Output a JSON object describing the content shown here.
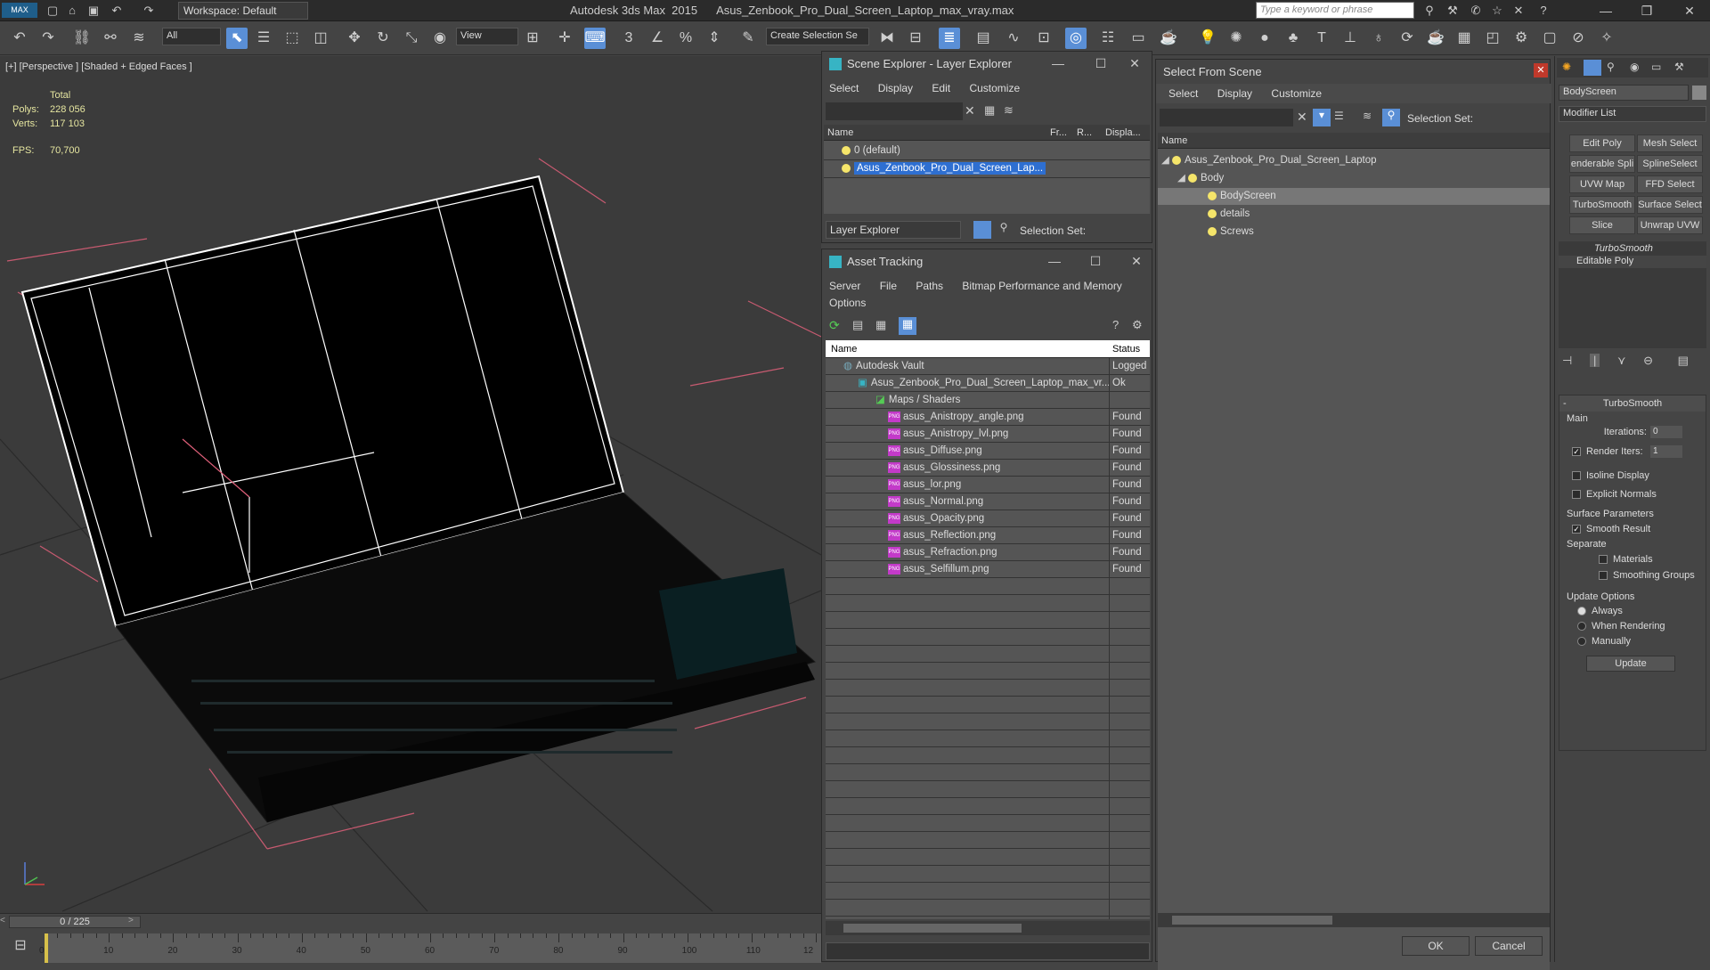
{
  "titlebar": {
    "workspace": "Workspace: Default",
    "app": "Autodesk 3ds Max  2015",
    "file": "Asus_Zenbook_Pro_Dual_Screen_Laptop_max_vray.max",
    "search_placeholder": "Type a keyword or phrase"
  },
  "toolbar": {
    "filter": "All",
    "refcoord": "View",
    "selection_set": "Create Selection Se"
  },
  "viewport": {
    "label": "[+] [Perspective ] [Shaded + Edged Faces ]",
    "stats_total": "Total",
    "polys_label": "Polys:",
    "polys_value": "228 056",
    "verts_label": "Verts:",
    "verts_value": "117 103",
    "fps_label": "FPS:",
    "fps_value": "70,700"
  },
  "timeline": {
    "slider": "0 / 225",
    "ticks": [
      "0",
      "10",
      "20",
      "30",
      "40",
      "50",
      "60",
      "70",
      "80",
      "90",
      "100",
      "110",
      "12"
    ]
  },
  "scene_explorer": {
    "title": "Scene Explorer - Layer Explorer",
    "menu": [
      "Select",
      "Display",
      "Edit",
      "Customize"
    ],
    "columns": [
      "Name",
      "Fr...",
      "R...",
      "Displa..."
    ],
    "rows": [
      "0 (default)",
      "Asus_Zenbook_Pro_Dual_Screen_Lap..."
    ],
    "footer_mode": "Layer Explorer",
    "footer_selset": "Selection Set:"
  },
  "asset_tracking": {
    "title": "Asset Tracking",
    "menu": [
      "Server",
      "File",
      "Paths",
      "Bitmap Performance and Memory"
    ],
    "menu2": "Options",
    "columns": [
      "Name",
      "Status"
    ],
    "rows": [
      {
        "name": "Autodesk Vault",
        "status": "Logged"
      },
      {
        "name": "Asus_Zenbook_Pro_Dual_Screen_Laptop_max_vr...",
        "status": "Ok"
      },
      {
        "name": "Maps / Shaders",
        "status": ""
      },
      {
        "name": "asus_Anistropy_angle.png",
        "status": "Found"
      },
      {
        "name": "asus_Anistropy_lvl.png",
        "status": "Found"
      },
      {
        "name": "asus_Diffuse.png",
        "status": "Found"
      },
      {
        "name": "asus_Glossiness.png",
        "status": "Found"
      },
      {
        "name": "asus_lor.png",
        "status": "Found"
      },
      {
        "name": "asus_Normal.png",
        "status": "Found"
      },
      {
        "name": "asus_Opacity.png",
        "status": "Found"
      },
      {
        "name": "asus_Reflection.png",
        "status": "Found"
      },
      {
        "name": "asus_Refraction.png",
        "status": "Found"
      },
      {
        "name": "asus_Selfillum.png",
        "status": "Found"
      }
    ]
  },
  "select_from_scene": {
    "title": "Select From Scene",
    "menu": [
      "Select",
      "Display",
      "Customize"
    ],
    "selset": "Selection Set:",
    "column": "Name",
    "tree": [
      "Asus_Zenbook_Pro_Dual_Screen_Laptop",
      "Body",
      "BodyScreen",
      "details",
      "Screws"
    ],
    "ok": "OK",
    "cancel": "Cancel"
  },
  "command_panel": {
    "object_name": "BodyScreen",
    "modifier_list": "Modifier List",
    "buttons": [
      "Edit Poly",
      "Mesh Select",
      "enderable Spli",
      "SplineSelect",
      "UVW Map",
      "FFD Select",
      "TurboSmooth",
      "Surface Select",
      "Slice",
      "Unwrap UVW"
    ],
    "stack": [
      "TurboSmooth",
      "Editable Poly"
    ],
    "rollout_title": "TurboSmooth",
    "main": "Main",
    "iterations_label": "Iterations:",
    "iterations_value": "0",
    "render_iters_label": "Render Iters:",
    "render_iters_value": "1",
    "isoline": "Isoline Display",
    "explicit": "Explicit Normals",
    "surface_params": "Surface Parameters",
    "smooth_result": "Smooth Result",
    "separate": "Separate",
    "materials": "Materials",
    "smoothing_groups": "Smoothing Groups",
    "update_options": "Update Options",
    "always": "Always",
    "when_rendering": "When Rendering",
    "manually": "Manually",
    "update": "Update"
  }
}
